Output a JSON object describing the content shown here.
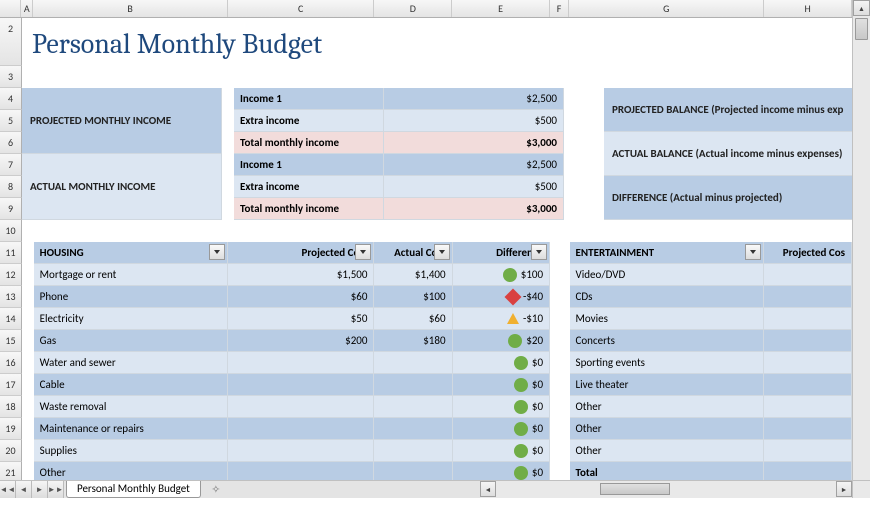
{
  "columns": [
    "A",
    "B",
    "C",
    "D",
    "E",
    "F",
    "G",
    "H"
  ],
  "rows": [
    "2",
    "3",
    "4",
    "5",
    "6",
    "7",
    "8",
    "9",
    "10",
    "11",
    "12",
    "13",
    "14",
    "15",
    "16",
    "17",
    "18",
    "19",
    "20",
    "21"
  ],
  "title": "Personal Monthly Budget",
  "tab": "Personal Monthly Budget",
  "income": {
    "proj_label": "PROJECTED MONTHLY INCOME",
    "act_label": "ACTUAL MONTHLY INCOME",
    "rows": [
      {
        "label": "Income 1",
        "val": "$2,500"
      },
      {
        "label": "Extra income",
        "val": "$500"
      },
      {
        "label": "Total monthly income",
        "val": "$3,000"
      }
    ],
    "rows2": [
      {
        "label": "Income 1",
        "val": "$2,500"
      },
      {
        "label": "Extra income",
        "val": "$500"
      },
      {
        "label": "Total monthly income",
        "val": "$3,000"
      }
    ]
  },
  "balance": {
    "r1": "PROJECTED BALANCE (Projected income minus exp",
    "r2": "ACTUAL BALANCE (Actual income minus expenses)",
    "r3": "DIFFERENCE (Actual minus projected)"
  },
  "housing": {
    "header": "HOUSING",
    "cols": [
      "Projected Cost",
      "Actual Cost",
      "Difference"
    ],
    "rows": [
      {
        "label": "Mortgage or rent",
        "pc": "$1,500",
        "ac": "$1,400",
        "icon": "g",
        "diff": "$100"
      },
      {
        "label": "Phone",
        "pc": "$60",
        "ac": "$100",
        "icon": "r",
        "diff": "-$40"
      },
      {
        "label": "Electricity",
        "pc": "$50",
        "ac": "$60",
        "icon": "y",
        "diff": "-$10"
      },
      {
        "label": "Gas",
        "pc": "$200",
        "ac": "$180",
        "icon": "g",
        "diff": "$20"
      },
      {
        "label": "Water and sewer",
        "pc": "",
        "ac": "",
        "icon": "g",
        "diff": "$0"
      },
      {
        "label": "Cable",
        "pc": "",
        "ac": "",
        "icon": "g",
        "diff": "$0"
      },
      {
        "label": "Waste removal",
        "pc": "",
        "ac": "",
        "icon": "g",
        "diff": "$0"
      },
      {
        "label": "Maintenance or repairs",
        "pc": "",
        "ac": "",
        "icon": "g",
        "diff": "$0"
      },
      {
        "label": "Supplies",
        "pc": "",
        "ac": "",
        "icon": "g",
        "diff": "$0"
      },
      {
        "label": "Other",
        "pc": "",
        "ac": "",
        "icon": "g",
        "diff": "$0"
      }
    ]
  },
  "ent": {
    "header": "ENTERTAINMENT",
    "col": "Projected Cos",
    "rows": [
      "Video/DVD",
      "CDs",
      "Movies",
      "Concerts",
      "Sporting events",
      "Live theater",
      "Other",
      "Other",
      "Other",
      "Total"
    ]
  }
}
